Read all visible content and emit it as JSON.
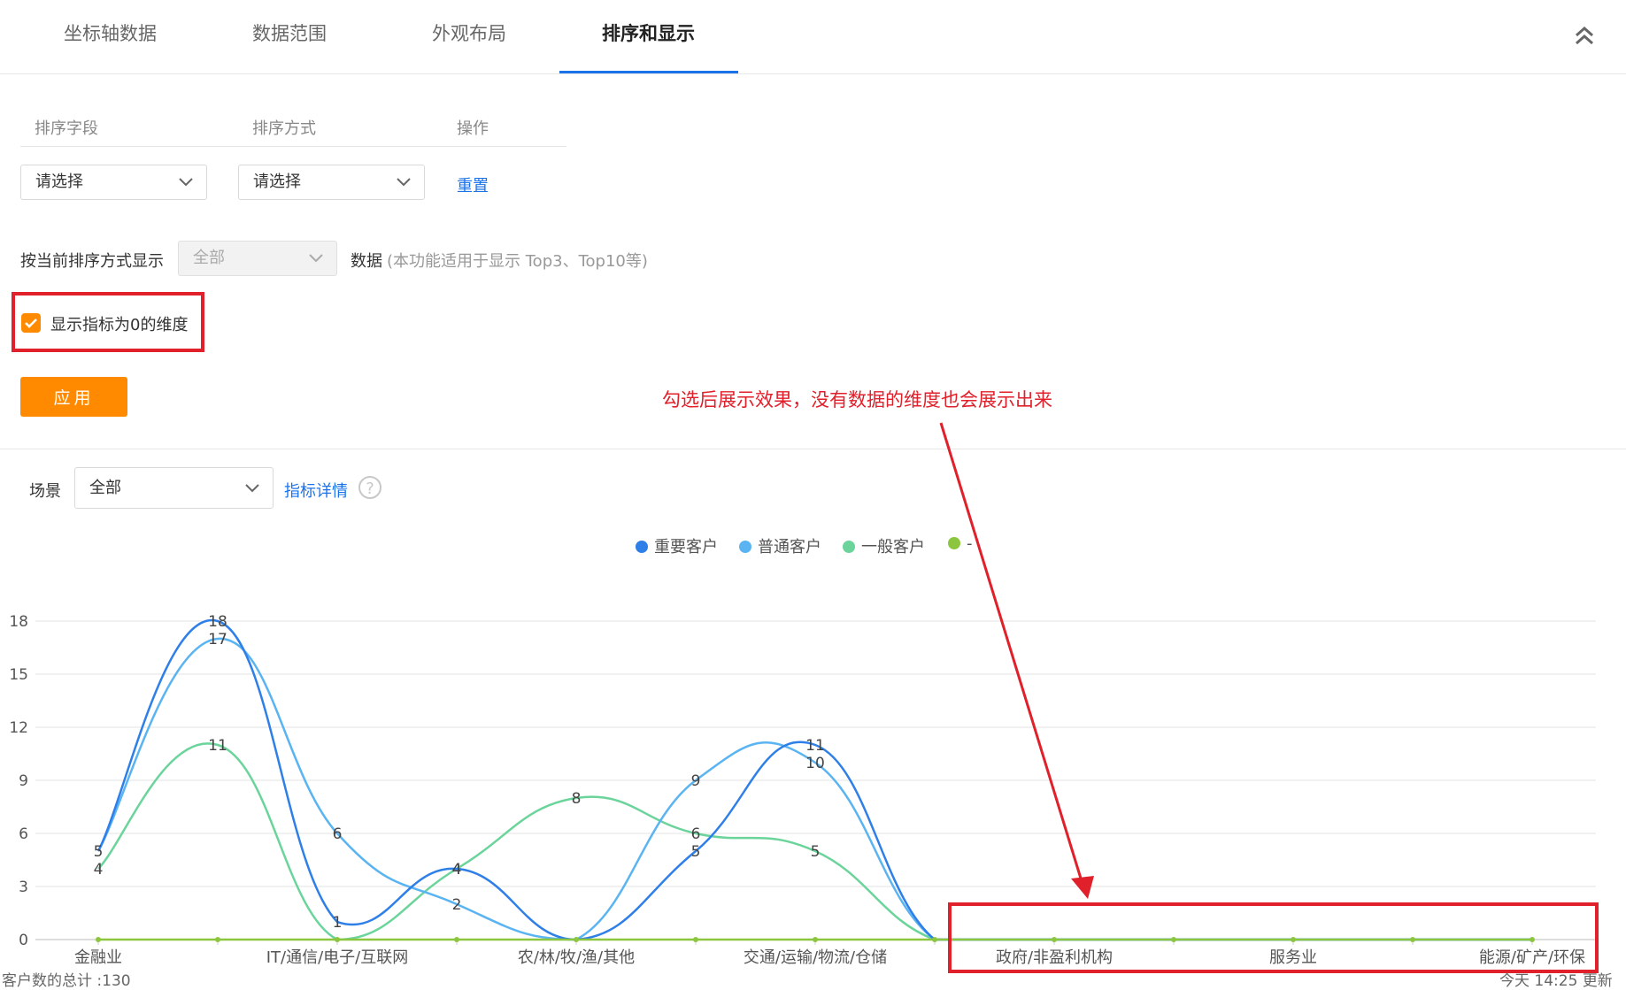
{
  "tabs": [
    {
      "label": "坐标轴数据",
      "active": false
    },
    {
      "label": "数据范围",
      "active": false
    },
    {
      "label": "外观布局",
      "active": false
    },
    {
      "label": "排序和显示",
      "active": true
    }
  ],
  "sort_table": {
    "headers": [
      "排序字段",
      "排序方式",
      "操作"
    ],
    "field_select": "请选择",
    "order_select": "请选择",
    "reset_label": "重置"
  },
  "display_by_order": {
    "label": "按当前排序方式显示",
    "select_value": "全部",
    "suffix_label": "数据",
    "hint": "(本功能适用于显示 Top3、Top10等)"
  },
  "show_zero_checkbox": {
    "label": "显示指标为0的维度",
    "checked": true
  },
  "apply_label": "应用",
  "annotation_text": "勾选后展示效果，没有数据的维度也会展示出来",
  "scene": {
    "label": "场景",
    "select_value": "全部",
    "detail_link": "指标详情",
    "help_glyph": "?"
  },
  "footer": {
    "left_text": "客户数的总计 :130",
    "right_text": "今天 14:25 更新"
  },
  "colors": {
    "accent_blue": "#1a73e8",
    "orange": "#ff8a00",
    "highlight_red": "#e0202a",
    "series_important": "#2f7fe8",
    "series_normal": "#5ab4f2",
    "series_general": "#6ad49b",
    "series_other": "#8cc63f"
  },
  "chart_data": {
    "type": "line",
    "smooth": true,
    "categories": [
      "金融业",
      "",
      "IT/通信/电子/互联网",
      "",
      "农/林/牧/渔/其他",
      "",
      "交通/运输/物流/仓储",
      "",
      "政府/非盈利机构",
      "",
      "服务业",
      "",
      "能源/矿产/环保"
    ],
    "yticks": [
      0,
      3,
      6,
      9,
      12,
      15,
      18
    ],
    "ylim": [
      0,
      18
    ],
    "grid": true,
    "legend_position": "top-center",
    "series": [
      {
        "name": "重要客户",
        "color": "#2f7fe8",
        "values": [
          5,
          18,
          1,
          4,
          0,
          5,
          11,
          0,
          0,
          0,
          0,
          0,
          0
        ],
        "labels": [
          true,
          true,
          true,
          true,
          false,
          true,
          true,
          false,
          false,
          false,
          false,
          false,
          false
        ]
      },
      {
        "name": "普通客户",
        "color": "#5ab4f2",
        "values": [
          5,
          17,
          6,
          2,
          0,
          9,
          10,
          0,
          0,
          0,
          0,
          0,
          0
        ],
        "labels": [
          false,
          true,
          true,
          true,
          false,
          true,
          true,
          false,
          false,
          false,
          false,
          false,
          false
        ]
      },
      {
        "name": "一般客户",
        "color": "#6ad49b",
        "values": [
          4,
          11,
          0,
          4,
          8,
          6,
          5,
          0,
          0,
          0,
          0,
          0,
          0
        ],
        "labels": [
          true,
          true,
          false,
          true,
          true,
          true,
          true,
          false,
          false,
          false,
          false,
          false,
          false
        ]
      },
      {
        "name": "-",
        "color": "#8cc63f",
        "values": [
          0,
          0,
          0,
          0,
          0,
          0,
          0,
          0,
          0,
          0,
          0,
          0,
          0
        ],
        "labels": [
          false,
          false,
          false,
          false,
          false,
          false,
          false,
          false,
          false,
          false,
          false,
          false,
          false
        ]
      }
    ]
  }
}
